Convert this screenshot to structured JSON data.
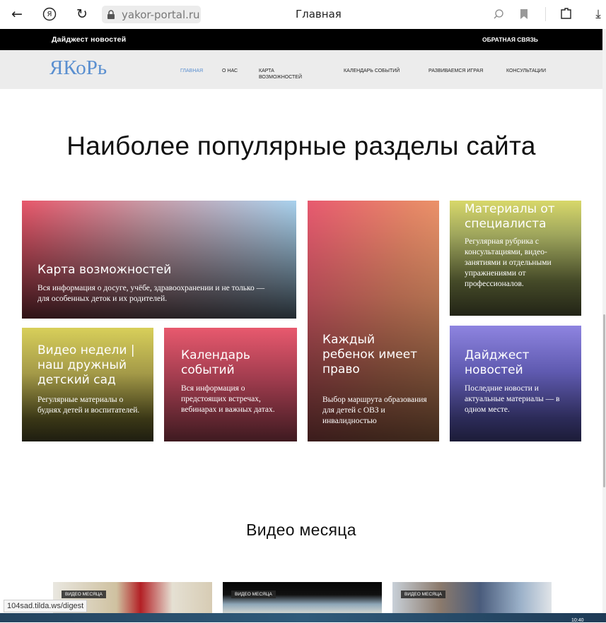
{
  "browser": {
    "url": "yakor-portal.ru",
    "tab_title": "Главная",
    "back_icon": "←",
    "reload_icon": "↻",
    "yandex_icon": "Я",
    "download_icon": "⤓"
  },
  "topbar": {
    "left": "Дайджест новостей",
    "right": "ОБРАТНАЯ СВЯЗЬ"
  },
  "nav": {
    "logo": "ЯКоРь",
    "items": [
      "ГЛАВНАЯ",
      "О НАС",
      "КАРТА ВОЗМОЖНОСТЕЙ",
      "КАЛЕНДАРЬ СОБЫТИЙ",
      "РАЗВИВАЕМСЯ ИГРАЯ",
      "КОНСУЛЬТАЦИИ"
    ],
    "active_color": "#5a8fd0"
  },
  "popular": {
    "title": "Наиболее популярные разделы сайта",
    "cards": [
      {
        "title": "Карта возможностей",
        "desc": "Вся информация о досуге, учёбе, здравоохранении и не только — для особенных деток и их родителей."
      },
      {
        "title": "Каждый ребенок имеет право",
        "desc": "Выбор маршрута образования для детей с ОВЗ и инвалидностью"
      },
      {
        "title": "Материалы от специалиста",
        "desc": "Регулярная рубрика с консультациями, видео-занятиями и отдельными упражнениями от профессионалов."
      },
      {
        "title": "Видео недели | наш дружный детский сад",
        "desc": "Регулярные материалы о буднях детей и воспитателей."
      },
      {
        "title": "Календарь событий",
        "desc": "Вся информация о предстоящих встречах, вебинарах и важных датах."
      },
      {
        "title": "Дайджест новостей",
        "desc": "Последние новости и актуальные материалы — в одном месте."
      }
    ]
  },
  "video": {
    "title": "Видео месяца",
    "label": "ВИДЕО МЕСЯЦА"
  },
  "status_url": "104sad.tilda.ws/digest",
  "clock": "10:40"
}
